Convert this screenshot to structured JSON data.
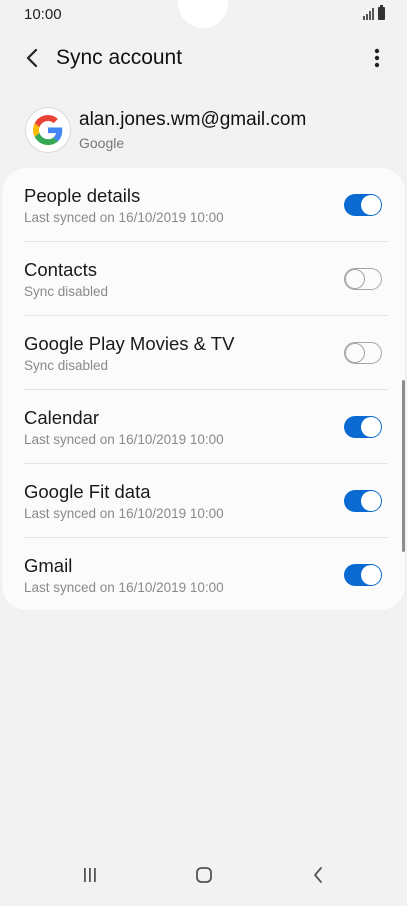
{
  "status_bar": {
    "time": "10:00"
  },
  "header": {
    "title": "Sync account",
    "back_icon": "chevron-left-icon",
    "more_icon": "more-vert-icon"
  },
  "account": {
    "email": "alan.jones.wm@gmail.com",
    "type": "Google",
    "logo_icon": "google-g-icon"
  },
  "sync_items": [
    {
      "title": "People details",
      "subtitle": "Last synced on 16/10/2019  10:00",
      "enabled": true
    },
    {
      "title": "Contacts",
      "subtitle": "Sync disabled",
      "enabled": false
    },
    {
      "title": "Google Play Movies & TV",
      "subtitle": "Sync disabled",
      "enabled": false
    },
    {
      "title": "Calendar",
      "subtitle": "Last synced on 16/10/2019  10:00",
      "enabled": true
    },
    {
      "title": "Google Fit data",
      "subtitle": "Last synced on 16/10/2019  10:00",
      "enabled": true
    },
    {
      "title": "Gmail",
      "subtitle": "Last synced on 16/10/2019  10:00",
      "enabled": true
    }
  ],
  "nav_bar": {
    "recents_icon": "recents-icon",
    "home_icon": "home-icon",
    "back_icon": "nav-back-icon"
  },
  "colors": {
    "accent": "#0a6ad1",
    "background": "#f2f2f2",
    "card": "#fbfbfb"
  }
}
